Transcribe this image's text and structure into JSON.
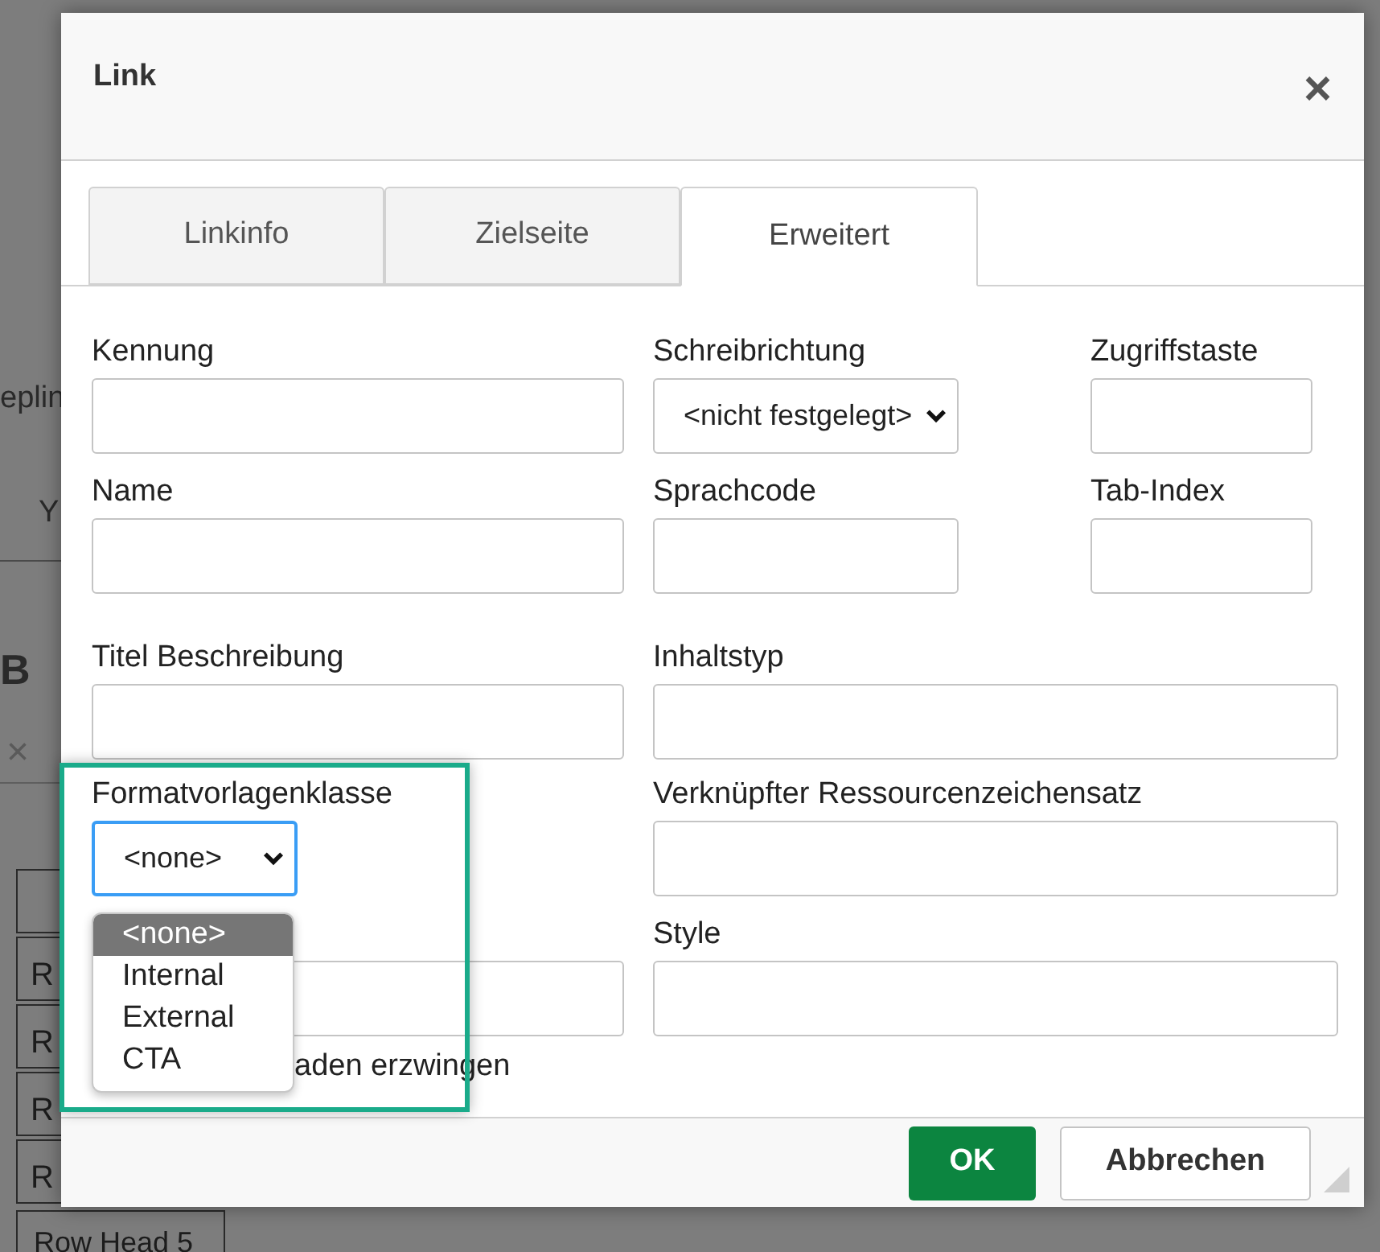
{
  "background_page": {
    "fragments": [
      {
        "kind": "text",
        "text": "eplin"
      },
      {
        "kind": "text",
        "text": "Y"
      },
      {
        "kind": "heading",
        "text": "B"
      },
      {
        "kind": "icon",
        "text": "×"
      }
    ],
    "table_rows": [
      {
        "cell": ""
      },
      {
        "cell": "R"
      },
      {
        "cell": "R"
      },
      {
        "cell": "R"
      },
      {
        "cell": "R"
      },
      {
        "cell": "Row Head 5"
      }
    ]
  },
  "dialog": {
    "title": "Link",
    "close": "×",
    "tabs": [
      {
        "label": "Linkinfo",
        "selected": false
      },
      {
        "label": "Zielseite",
        "selected": false
      },
      {
        "label": "Erweitert",
        "selected": true
      }
    ],
    "rows": [
      [
        {
          "label": "Kennung",
          "kind": "text"
        },
        {
          "label": "Schreibrichtung",
          "kind": "select",
          "value": "<nicht festgelegt>",
          "focused": false
        },
        {
          "label": "Zugriffstaste",
          "kind": "text"
        }
      ],
      [
        {
          "label": "Name",
          "kind": "text"
        },
        {
          "label": "Sprachcode",
          "kind": "text"
        },
        {
          "label": "Tab-Index",
          "kind": "text"
        }
      ],
      [
        {
          "label": "Titel Beschreibung",
          "kind": "text"
        },
        {
          "label": "Inhaltstyp",
          "kind": "text"
        }
      ],
      [
        {
          "label": "Formatvorlagenklasse",
          "kind": "select",
          "value": "<none>",
          "focused": true
        },
        {
          "label": "Verknüpfter Ressourcenzeichensatz",
          "kind": "text"
        }
      ],
      [
        {
          "kind": "text"
        },
        {
          "label": "Style",
          "kind": "text"
        }
      ]
    ],
    "checkbox": {
      "label": "aden erzwingen"
    },
    "open_dropdown": {
      "options": [
        {
          "label": "<none>",
          "selected": true
        },
        {
          "label": "Internal",
          "selected": false
        },
        {
          "label": "External",
          "selected": false
        },
        {
          "label": "CTA",
          "selected": false
        }
      ]
    },
    "buttons": [
      {
        "label": "OK",
        "kind": "primary"
      },
      {
        "label": "Abbrechen",
        "kind": "secondary"
      }
    ]
  }
}
